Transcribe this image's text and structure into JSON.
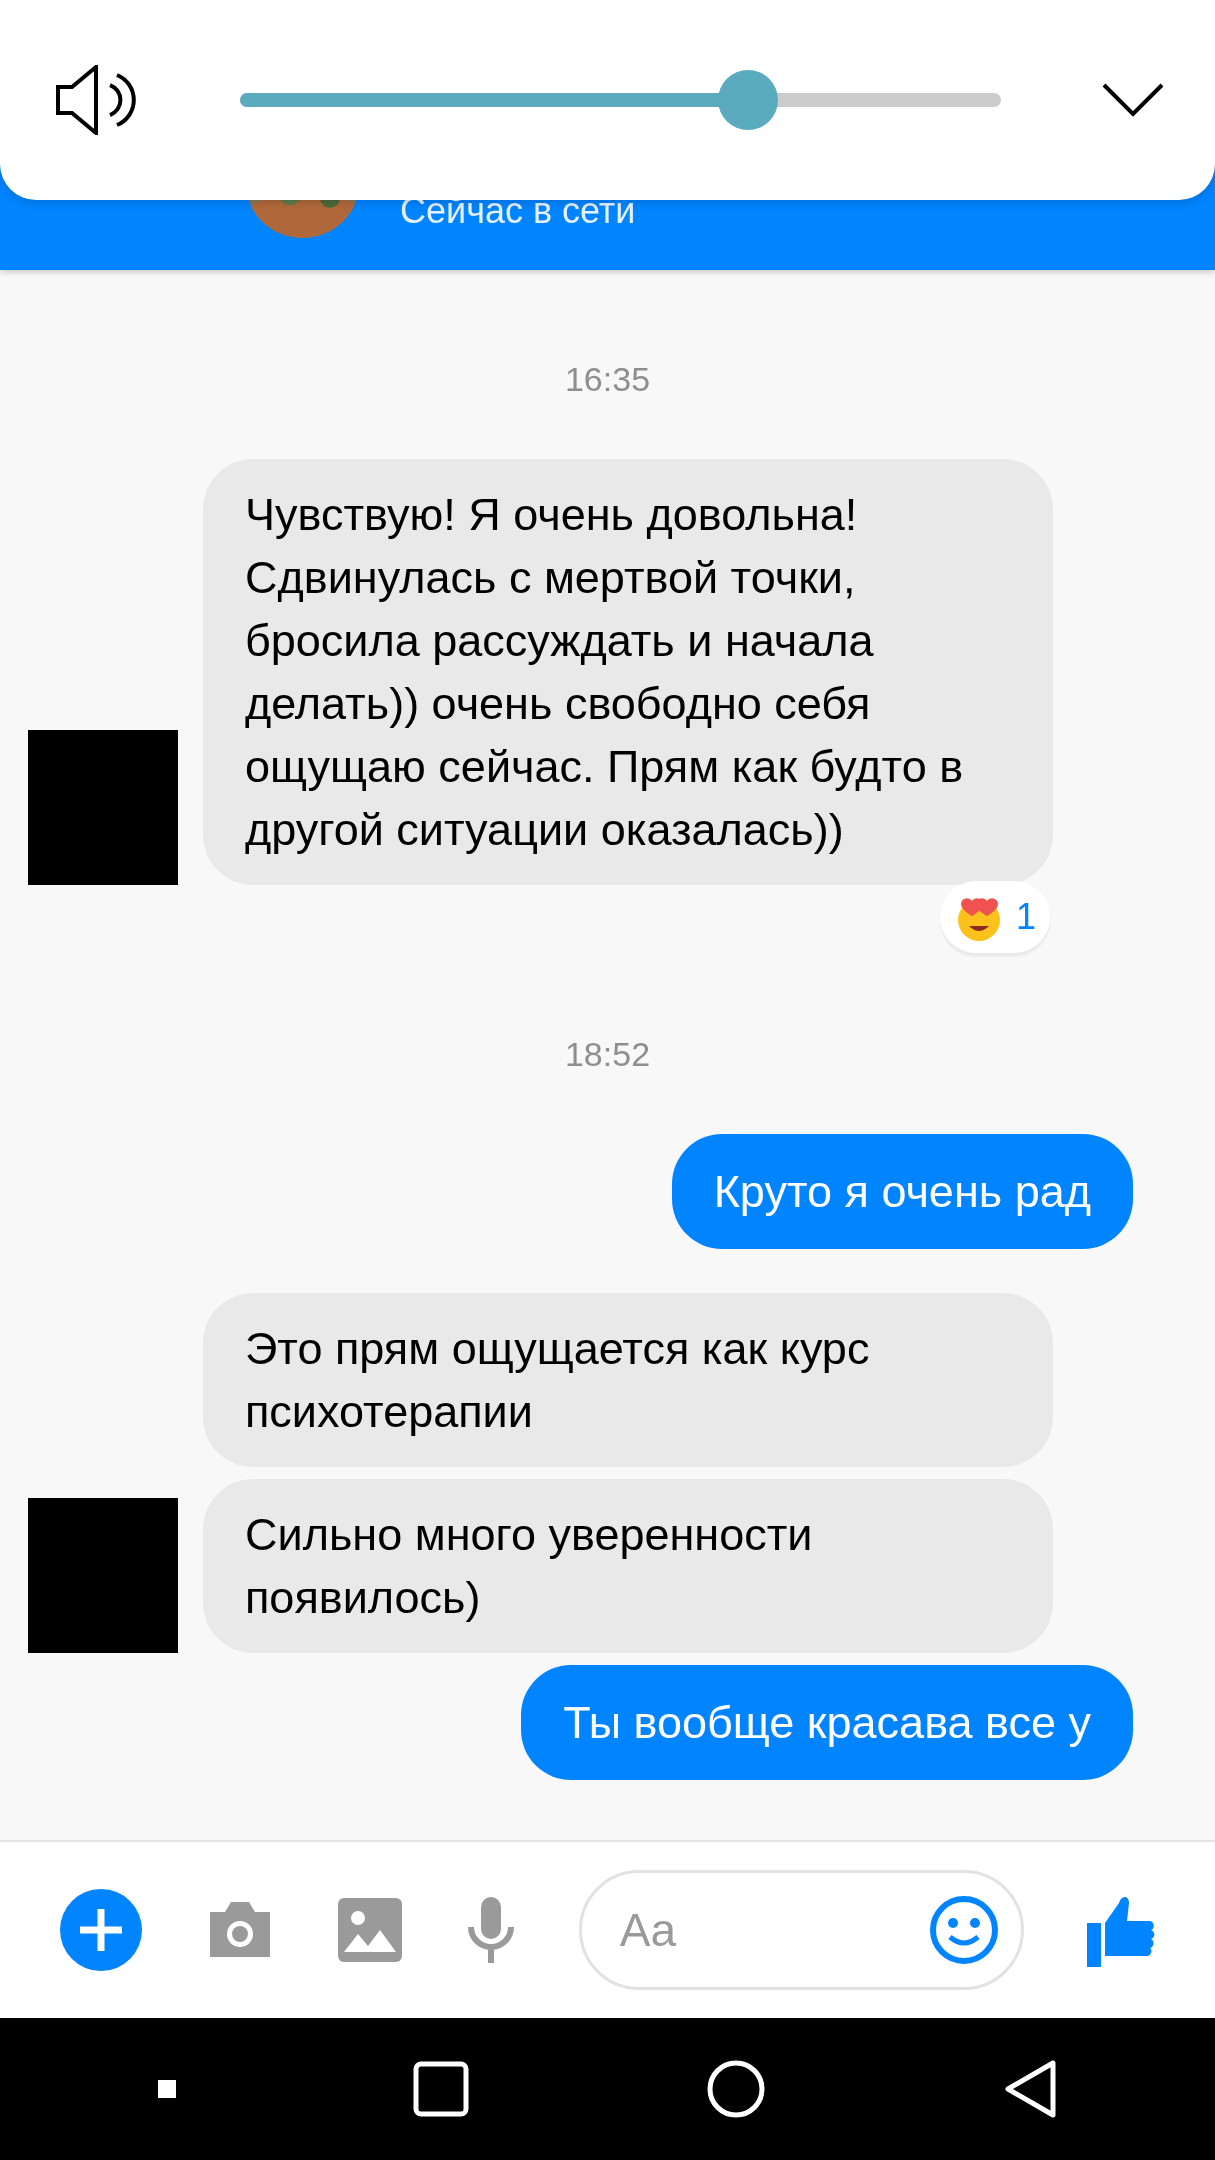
{
  "volume_panel": {
    "level": 0.667
  },
  "header": {
    "status": "Сейчас в сети"
  },
  "messages": [
    {
      "kind": "time",
      "text": "16:35"
    },
    {
      "kind": "received",
      "text": "Чувствую! Я очень довольна! Сдвинулась с мертвой точки, бросила рассуждать и начала делать)) очень свободно себя ощущаю сейчас. Прям как будто в другой ситуации оказалась))",
      "avatar": true,
      "reaction": {
        "count": "1"
      }
    },
    {
      "kind": "time",
      "text": "18:52"
    },
    {
      "kind": "sent",
      "text": "Круто я очень рад"
    },
    {
      "kind": "received",
      "text": "Это прям ощущается как курс психотерапии",
      "avatar": false
    },
    {
      "kind": "received",
      "text": "Сильно много уверенности появилось)",
      "avatar": true
    },
    {
      "kind": "sent",
      "text": "Ты вообще красава все у"
    }
  ],
  "composer": {
    "placeholder": "Aa"
  }
}
